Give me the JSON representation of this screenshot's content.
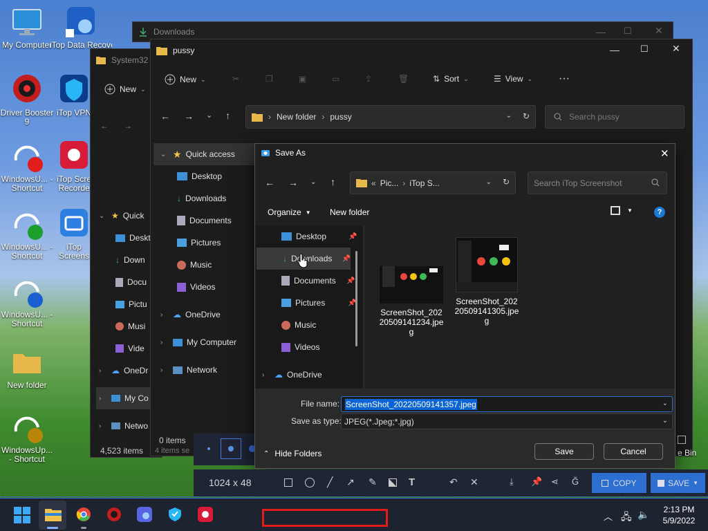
{
  "desktop_icons": [
    {
      "name": "desktop-icon-my-computer",
      "label": "My Computer"
    },
    {
      "name": "desktop-icon-itop-data-recovery",
      "label": "iTop Data Recove"
    },
    {
      "name": "desktop-icon-driver-booster",
      "label": "Driver Booster 9"
    },
    {
      "name": "desktop-icon-itop-vpn",
      "label": "iTop VPN"
    },
    {
      "name": "desktop-icon-windows-update-1",
      "label": "WindowsU... - Shortcut"
    },
    {
      "name": "desktop-icon-itop-screen-recorder",
      "label": "iTop Scre Recorde"
    },
    {
      "name": "desktop-icon-windows-update-2",
      "label": "WindowsU... - Shortcut"
    },
    {
      "name": "desktop-icon-itop-screenshot",
      "label": "iTop Screens"
    },
    {
      "name": "desktop-icon-windows-update-3",
      "label": "WindowsU... - Shortcut"
    },
    {
      "name": "desktop-icon-new-folder",
      "label": "New folder"
    },
    {
      "name": "desktop-icon-windows-update-4",
      "label": "WindowsUp... - Shortcut"
    }
  ],
  "win_downloads": {
    "title": "Downloads"
  },
  "win_system32": {
    "title": "System32",
    "new": "New",
    "sidebar": [
      "Quick",
      "Deskt",
      "Down",
      "Docu",
      "Pictu",
      "Musi",
      "Vide",
      "OneDr",
      "My Co",
      "Netwo"
    ],
    "status": "4,523 items"
  },
  "win_pussy": {
    "title": "pussy",
    "toolbar": {
      "new": "New",
      "sort": "Sort",
      "view": "View",
      "more": "···"
    },
    "path": [
      "New folder",
      "pussy"
    ],
    "search_placeholder": "Search pussy",
    "sidebar": {
      "quick_access": "Quick access",
      "items": [
        "Desktop",
        "Downloads",
        "Documents",
        "Pictures",
        "Music",
        "Videos"
      ],
      "onedrive": "OneDrive",
      "my_computer": "My Computer",
      "network": "Network"
    },
    "status": "0 items",
    "status2": "4 items se"
  },
  "save_dialog": {
    "title": "Save As",
    "path": [
      "«",
      "Pic...",
      "iTop S..."
    ],
    "search_placeholder": "Search iTop Screenshot",
    "organize": "Organize",
    "new_folder": "New folder",
    "help": "?",
    "sidebar": [
      "Desktop",
      "Downloads",
      "Documents",
      "Pictures",
      "Music",
      "Videos",
      "OneDrive"
    ],
    "files": [
      {
        "name": "ScreenShot_20220509141234.jpeg"
      },
      {
        "name": "ScreenShot_20220509141305.jpeg"
      }
    ],
    "filename_label": "File name:",
    "filename_value": "ScreenShot_20220509141357.jpeg",
    "type_label": "Save as type:",
    "type_value": "JPEG(*.Jpeg;*.jpg)",
    "hide_folders": "Hide Folders",
    "save": "Save",
    "cancel": "Cancel"
  },
  "capture_toolbar": {
    "size": "1024 x 48",
    "copy": "COPY",
    "save": "SAVE"
  },
  "recycle_bin": "e Bin",
  "taskbar": {
    "time": "2:13 PM",
    "date": "5/9/2022"
  },
  "colors": {
    "accent": "#2f6fd4",
    "selection": "#0a64d6",
    "highlight_box": "#e21b1b"
  }
}
